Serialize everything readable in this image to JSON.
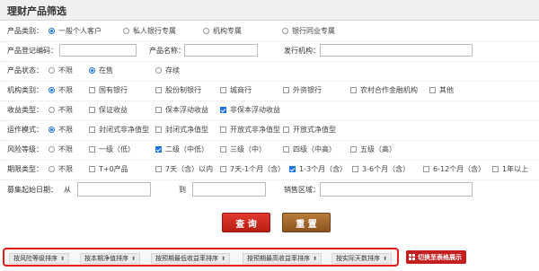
{
  "title": "理财产品筛选",
  "product_type": {
    "label": "产品类别：",
    "options": [
      "一般个人客户",
      "私人银行专属",
      "机构专属",
      "银行同业专属"
    ],
    "selected": 0
  },
  "code_row": {
    "code_label": "产品登记编码：",
    "name_label": "产品名称：",
    "issuer_label": "发行机构："
  },
  "status": {
    "label": "产品状态：",
    "options": [
      "不限",
      "在售",
      "存续"
    ],
    "selected": 1
  },
  "institution": {
    "label": "机构类别：",
    "any": "不限",
    "options": [
      "国有银行",
      "股份制银行",
      "城商行",
      "外资银行",
      "农村合作金融机构",
      "其他"
    ]
  },
  "income": {
    "label": "收益类型：",
    "any": "不限",
    "options": [
      "保证收益",
      "保本浮动收益",
      "非保本浮动收益"
    ],
    "checked": [
      2
    ]
  },
  "operation": {
    "label": "运作模式：",
    "any": "不限",
    "options": [
      "封闭式非净值型",
      "封闭式净值型",
      "开放式非净值型",
      "开放式净值型"
    ]
  },
  "risk": {
    "label": "风险等级：",
    "any": "不限",
    "options": [
      "一级（低）",
      "二级（中低）",
      "三级（中）",
      "四级（中高）",
      "五级（高）"
    ],
    "checked": [
      1
    ]
  },
  "term": {
    "label": "期限类型：",
    "any": "不限",
    "options": [
      "T+0产品",
      "7天（含）以内",
      "7天-1个月（含）",
      "1-3个月（含）",
      "3-6个月（含）",
      "6-12个月（含）",
      "1年以上"
    ],
    "checked": [
      3
    ]
  },
  "raise": {
    "label": "募集起始日期：",
    "from": "从",
    "to": "到",
    "area_label": "销售区域："
  },
  "buttons": {
    "query": "查 询",
    "reset": "重 置"
  },
  "sort": {
    "items": [
      "按风险等级排序",
      "按本期净值排序",
      "按预期最低收益率排序",
      "按预期最高收益率排序",
      "按实际天数排序"
    ],
    "arrow": "⬍",
    "switch_label": "切换至表格展示"
  }
}
